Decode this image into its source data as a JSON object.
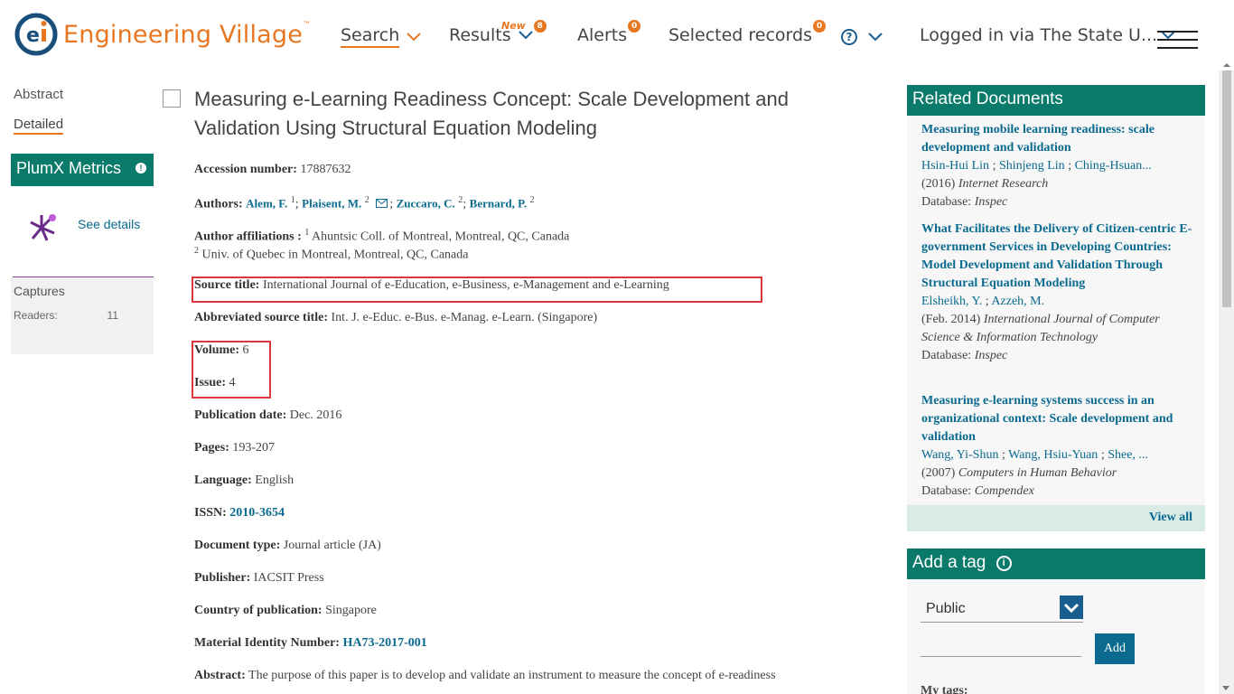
{
  "header": {
    "logo_text": "Engineering Village",
    "logo_tm": "™",
    "nav": {
      "search": "Search",
      "results": "Results",
      "results_new": "New",
      "results_count": "8",
      "alerts": "Alerts",
      "alerts_count": "0",
      "selected": "Selected records",
      "selected_count": "0",
      "help": "?",
      "logged_in": "Logged in via The State U..."
    }
  },
  "left": {
    "tabs": [
      "Abstract",
      "Detailed"
    ],
    "plumx_title": "PlumX Metrics",
    "see_details": "See details",
    "captures": "Captures",
    "readers_label": "Readers:",
    "readers_value": "11"
  },
  "record": {
    "title": "Measuring e-Learning Readiness Concept: Scale Development and Validation Using Structural Equation Modeling",
    "accession_label": "Accession number:",
    "accession": "17887632",
    "authors_label": "Authors:",
    "authors": [
      {
        "name": "Alem, F.",
        "sup": "1"
      },
      {
        "name": "Plaisent, M.",
        "sup": "2"
      },
      {
        "name": "Zuccaro, C.",
        "sup": "2"
      },
      {
        "name": "Bernard, P.",
        "sup": "2"
      }
    ],
    "affiliations_label": "Author affiliations :",
    "affiliation1_sup": "1",
    "affiliation1": "Ahuntsic Coll. of Montreal, Montreal, QC, Canada",
    "affiliation2_sup": "2",
    "affiliation2": "Univ. of Quebec in Montreal, Montreal, QC, Canada",
    "source_label": "Source title:",
    "source": "International Journal of e-Education, e-Business, e-Management and e-Learning",
    "abbrev_label": "Abbreviated source title:",
    "abbrev": "Int. J. e-Educ. e-Bus. e-Manag. e-Learn. (Singapore)",
    "volume_label": "Volume:",
    "volume": "6",
    "issue_label": "Issue:",
    "issue": "4",
    "pubdate_label": "Publication date:",
    "pubdate": "Dec. 2016",
    "pages_label": "Pages:",
    "pages": "193-207",
    "language_label": "Language:",
    "language": "English",
    "issn_label": "ISSN:",
    "issn": "2010-3654",
    "doctype_label": "Document type:",
    "doctype": "Journal article (JA)",
    "publisher_label": "Publisher:",
    "publisher": "IACSIT Press",
    "country_label": "Country of publication:",
    "country": "Singapore",
    "material_label": "Material Identity Number:",
    "material": "HA73-2017-001",
    "abstract_label": "Abstract:",
    "abstract": "The purpose of this paper is to develop and validate an instrument to measure the concept of e-readiness"
  },
  "related": {
    "title": "Related Documents",
    "items": [
      {
        "title": "Measuring mobile learning readiness: scale development and validation",
        "authors": [
          "Hsin-Hui Lin",
          "Shinjeng Lin",
          "Ching-Hsuan..."
        ],
        "year": "(2016)",
        "journal": "Internet Research",
        "db_label": "Database:",
        "db": "Inspec"
      },
      {
        "title": "What Facilitates the Delivery of Citizen-centric E-government Services in Developing Countries: Model Development and Validation Through Structural Equation Modeling",
        "authors": [
          "Elsheikh, Y.",
          "Azzeh, M."
        ],
        "year": "(Feb. 2014)",
        "journal": "International Journal of Computer Science & Information Technology",
        "db_label": "Database:",
        "db": "Inspec"
      },
      {
        "title": "Measuring e-learning systems success in an organizational context: Scale development and validation",
        "authors": [
          "Wang, Yi-Shun",
          "Wang, Hsiu-Yuan",
          "Shee, ..."
        ],
        "year": "(2007)",
        "journal": "Computers in Human Behavior",
        "db_label": "Database:",
        "db": "Compendex"
      }
    ],
    "view_all": "View all"
  },
  "tags": {
    "title": "Add a tag",
    "info": "i",
    "visibility": "Public",
    "add": "Add",
    "my_tags": "My tags:"
  },
  "colors": {
    "accent_orange": "#e87722",
    "panel_green": "#0a7a6a",
    "link_blue": "#0a6a8f",
    "highlight_red": "#d9363e"
  }
}
